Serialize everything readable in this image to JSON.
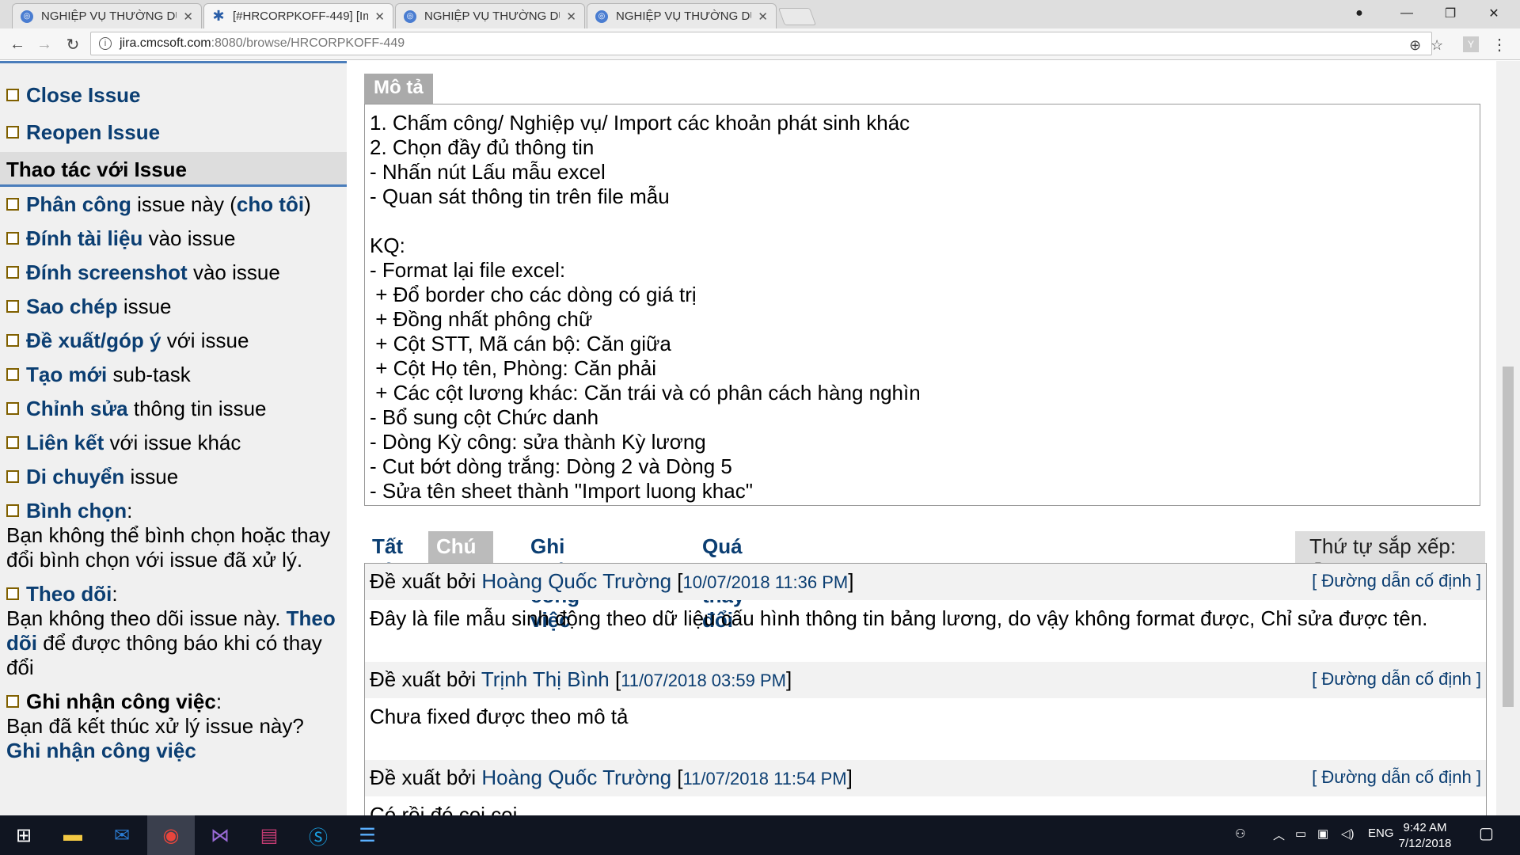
{
  "browser": {
    "tabs": [
      {
        "title": "NGHIỆP VỤ THƯỜNG DÙ",
        "active": false
      },
      {
        "title": "[#HRCORPKOFF-449] [Im",
        "active": true
      },
      {
        "title": "NGHIỆP VỤ THƯỜNG DÙ",
        "active": false
      },
      {
        "title": "NGHIỆP VỤ THƯỜNG DÙ",
        "active": false
      }
    ],
    "url_host": "jira.cmcsoft.com",
    "url_path": ":8080/browse/HRCORPKOFF-449"
  },
  "sidebar": {
    "top_actions": [
      {
        "label": "Close Issue"
      },
      {
        "label": "Reopen Issue"
      }
    ],
    "section_title": "Thao tác với Issue",
    "actions": [
      {
        "link": "Phân công",
        "rest": " issue này (",
        "link2": "cho tôi",
        "rest2": ")"
      },
      {
        "link": "Đính tài liệu",
        "rest": " vào issue",
        "link2": "",
        "rest2": ""
      },
      {
        "link": "Đính screenshot",
        "rest": " vào issue",
        "link2": "",
        "rest2": ""
      },
      {
        "link": "Sao chép",
        "rest": " issue",
        "link2": "",
        "rest2": ""
      },
      {
        "link": "Đề xuất/góp ý",
        "rest": " với issue",
        "link2": "",
        "rest2": ""
      },
      {
        "link": "Tạo mới",
        "rest": " sub-task",
        "link2": "",
        "rest2": ""
      },
      {
        "link": "Chỉnh sửa",
        "rest": " thông tin issue",
        "link2": "",
        "rest2": ""
      },
      {
        "link": "Liên kết",
        "rest": " với issue khác",
        "link2": "",
        "rest2": ""
      },
      {
        "link": "Di chuyển",
        "rest": " issue",
        "link2": "",
        "rest2": ""
      }
    ],
    "vote_label": "Bình chọn",
    "vote_text": "Bạn không thể bình chọn hoặc thay đổi bình chọn với issue đã xử lý.",
    "watch_label": "Theo dõi",
    "watch_text1": "Bạn không theo dõi issue này.",
    "watch_link": "Theo dõi",
    "watch_text2": "để được thông báo khi có thay đổi",
    "worklog_label": "Ghi nhận công việc",
    "worklog_text": "Bạn đã kết thúc xử lý issue này?",
    "worklog_link": "Ghi nhận công việc"
  },
  "description": {
    "label": "Mô tả",
    "text": "1. Chấm công/ Nghiệp vụ/ Import các khoản phát sinh khác\n2. Chọn đầy đủ thông tin\n- Nhấn nút Lấu mẫu excel\n- Quan sát thông tin trên file mẫu\n\nKQ:\n- Format lại file excel:\n + Đổ border cho các dòng có giá trị\n + Đồng nhất phông chữ\n + Cột STT, Mã cán bộ: Căn giữa\n + Cột Họ tên, Phòng: Căn phải\n + Các cột lương khác: Căn trái và có phân cách hàng nghìn\n- Bổ sung cột Chức danh\n- Dòng Kỳ công: sửa thành Kỳ lương\n- Cut bớt dòng trắng: Dòng 2 và Dòng 5\n- Sửa tên sheet thành \"Import luong khac\""
  },
  "activity_tabs": [
    {
      "label": "Tất cả",
      "selected": false
    },
    {
      "label": "Chú thích",
      "selected": true
    },
    {
      "label": "Ghi nhận công việc",
      "selected": false
    },
    {
      "label": "Quá trình thay đổi",
      "selected": false
    }
  ],
  "sort_label": "Thứ tự sắp xếp:",
  "comments": [
    {
      "prefix": "Đề xuất bởi",
      "author": "Hoàng Quốc Trường",
      "date": "10/07/2018 11:36 PM",
      "permalink": "Đường dẫn cố định",
      "body": "Đây là file mẫu sinh động theo dữ liệu cấu hình thông tin bảng lương, do vậy không format được, Chỉ sửa được tên."
    },
    {
      "prefix": "Đề xuất bởi",
      "author": "Trịnh Thị Bình",
      "date": "11/07/2018 03:59 PM",
      "permalink": "Đường dẫn cố định",
      "body": "Chưa fixed được theo mô tả"
    },
    {
      "prefix": "Đề xuất bởi",
      "author": "Hoàng Quốc Trường",
      "date": "11/07/2018 11:54 PM",
      "permalink": "Đường dẫn cố định",
      "body": "Có rồi đó coi coi"
    }
  ],
  "taskbar": {
    "lang": "ENG",
    "time": "9:42 AM",
    "date": "7/12/2018"
  }
}
